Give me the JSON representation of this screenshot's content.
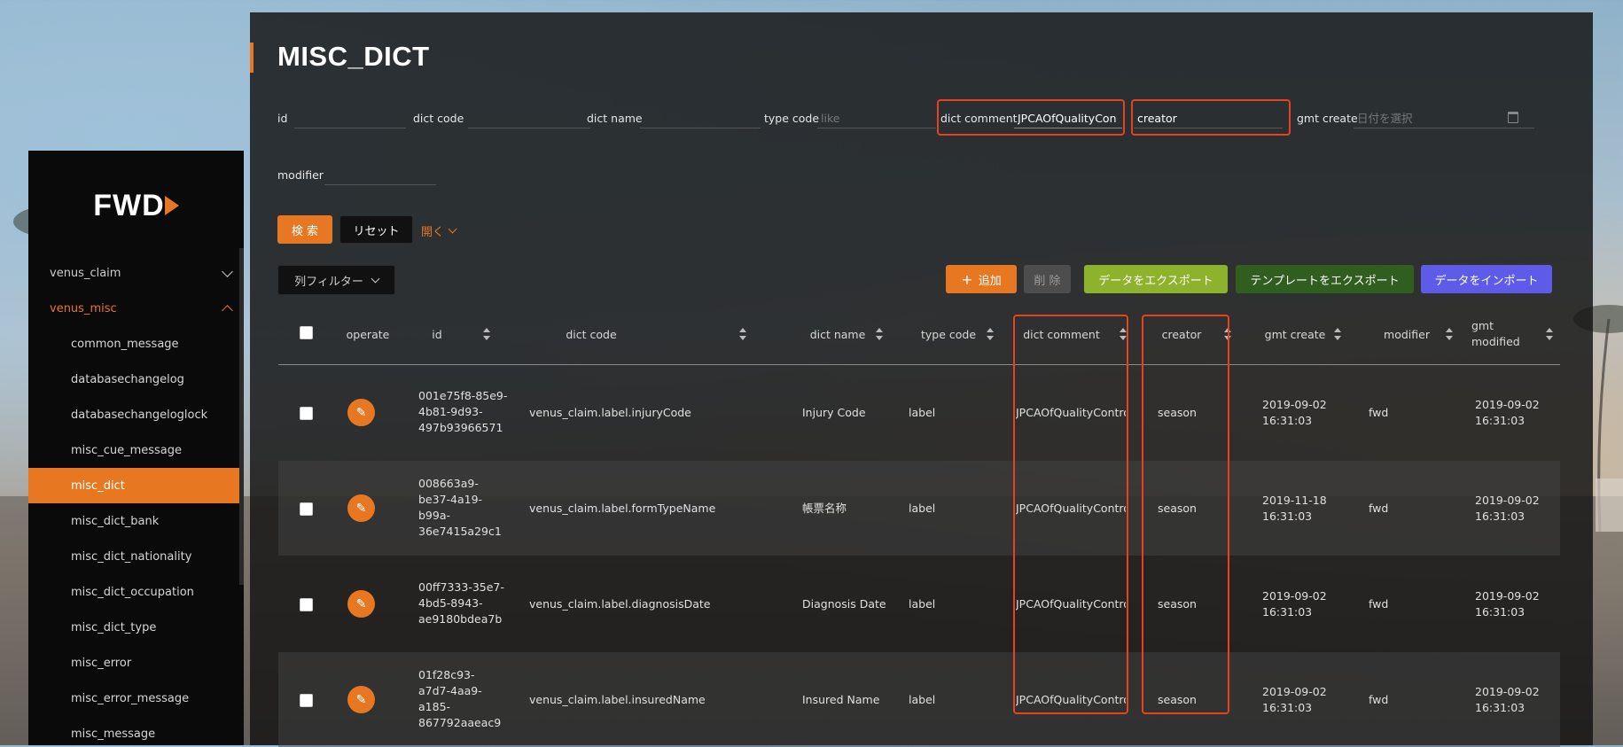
{
  "sidebar": {
    "logo": "FWD",
    "groups": [
      {
        "label": "venus_claim"
      },
      {
        "label": "venus_misc"
      }
    ],
    "items": [
      {
        "label": "common_message"
      },
      {
        "label": "databasechangelog"
      },
      {
        "label": "databasechangeloglock"
      },
      {
        "label": "misc_cue_message"
      },
      {
        "label": "misc_dict"
      },
      {
        "label": "misc_dict_bank"
      },
      {
        "label": "misc_dict_nationality"
      },
      {
        "label": "misc_dict_occupation"
      },
      {
        "label": "misc_dict_type"
      },
      {
        "label": "misc_error"
      },
      {
        "label": "misc_error_message"
      },
      {
        "label": "misc_message"
      }
    ],
    "active_item": "misc_dict"
  },
  "page": {
    "title": "MISC_DICT"
  },
  "filters": {
    "id": {
      "label": "id",
      "value": ""
    },
    "dict_code": {
      "label": "dict code",
      "value": ""
    },
    "dict_name": {
      "label": "dict name",
      "value": ""
    },
    "type_code": {
      "label": "type code",
      "placeholder": "like"
    },
    "dict_comment": {
      "label": "dict comment",
      "value": "JPCAOfQualityCon"
    },
    "creator": {
      "label": "creator",
      "value": "creator"
    },
    "gmt_create": {
      "label": "gmt create",
      "placeholder": "日付を選択"
    },
    "modifier": {
      "label": "modifier",
      "value": ""
    }
  },
  "actions": {
    "search": "検 索",
    "reset": "リセット",
    "expand": "開く",
    "column_filter": "列フィルター",
    "add": "追加",
    "delete": "削 除",
    "export_data": "データをエクスポート",
    "export_template": "テンプレートをエクスポート",
    "import_data": "データをインポート"
  },
  "table": {
    "headers": [
      "operate",
      "id",
      "dict code",
      "dict name",
      "type code",
      "dict comment",
      "creator",
      "gmt create",
      "modifier",
      "gmt modified"
    ],
    "rows": [
      {
        "id": [
          "001e75f8-85e9-",
          "4b81-9d93-",
          "497b93966571"
        ],
        "dict_code": "venus_claim.label.injuryCode",
        "dict_name": "Injury Code",
        "type_code": "label",
        "dict_comment": "JPCAOfQualityContro",
        "creator": "season",
        "gmt_create": [
          "2019-09-02",
          "16:31:03"
        ],
        "modifier": "fwd",
        "gmt_modified": [
          "2019-09-02",
          "16:31:03"
        ]
      },
      {
        "id": [
          "008663a9-",
          "be37-4a19-",
          "b99a-",
          "36e7415a29c1"
        ],
        "dict_code": "venus_claim.label.formTypeName",
        "dict_name": "帳票名称",
        "type_code": "label",
        "dict_comment": "JPCAOfQualityContro",
        "creator": "season",
        "gmt_create": [
          "2019-11-18",
          "16:31:03"
        ],
        "modifier": "fwd",
        "gmt_modified": [
          "2019-09-02",
          "16:31:03"
        ]
      },
      {
        "id": [
          "00ff7333-35e7-",
          "4bd5-8943-",
          "ae9180bdea7b"
        ],
        "dict_code": "venus_claim.label.diagnosisDate",
        "dict_name": "Diagnosis Date",
        "type_code": "label",
        "dict_comment": "JPCAOfQualityContro",
        "creator": "season",
        "gmt_create": [
          "2019-09-02",
          "16:31:03"
        ],
        "modifier": "fwd",
        "gmt_modified": [
          "2019-09-02",
          "16:31:03"
        ]
      },
      {
        "id": [
          "01f28c93-",
          "a7d7-4aa9-",
          "a185-",
          "867792aaeac9"
        ],
        "dict_code": "venus_claim.label.insuredName",
        "dict_name": "Insured Name",
        "type_code": "label",
        "dict_comment": "JPCAOfQualityContro",
        "creator": "season",
        "gmt_create": [
          "2019-09-02",
          "16:31:03"
        ],
        "modifier": "fwd",
        "gmt_modified": [
          "2019-09-02",
          "16:31:03"
        ]
      }
    ]
  },
  "colors": {
    "accent": "#e87722",
    "highlight": "#e5421f",
    "lime": "#8db32c",
    "green": "#2f5e1f",
    "blue": "#5d5be8"
  }
}
